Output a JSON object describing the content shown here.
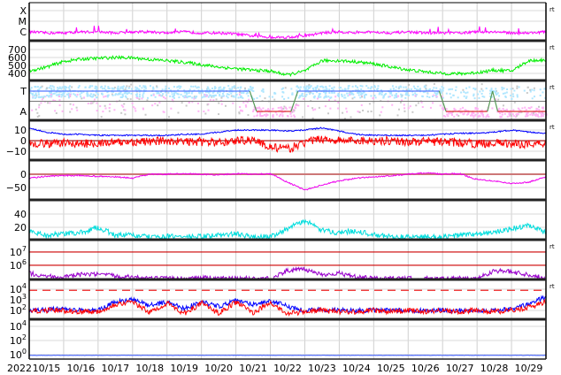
{
  "chart_data": {
    "type": "line",
    "title": "",
    "x_axis": {
      "year_label": "2022",
      "start": "10/15 00:00",
      "days": 15,
      "tick_labels": [
        "10/15",
        "10/16",
        "10/17",
        "10/18",
        "10/19",
        "10/20",
        "10/21",
        "10/22",
        "10/23",
        "10/24",
        "10/25",
        "10/26",
        "10/27",
        "10/28",
        "10/29"
      ]
    },
    "sample_step_days": 0.5,
    "panels": [
      {
        "name": "xray-flux",
        "scale": "log",
        "ylim": [
          -6.83,
          -3.25
        ],
        "rt": "rt",
        "ticks": [
          {
            "v": -4,
            "label": "X"
          },
          {
            "v": -5,
            "label": "M"
          },
          {
            "v": -6,
            "label": "C"
          }
        ],
        "series": [
          {
            "name": "xray",
            "color": "#ff00ff",
            "noise": 0.25,
            "spikes": 0.6,
            "values": [
              -6.0,
              -6.1,
              -6.1,
              -6.0,
              -6.0,
              -6.1,
              -6.0,
              -6.0,
              -6.1,
              -6.0,
              -6.1,
              -6.1,
              -6.2,
              -6.4,
              -6.5,
              -6.5,
              -6.4,
              -6.1,
              -6.0,
              -6.1,
              -6.0,
              -6.1,
              -6.0,
              -6.1,
              -6.1,
              -6.1,
              -6.0,
              -6.0,
              -6.1,
              -6.1,
              -6.0
            ]
          }
        ]
      },
      {
        "name": "solar-wind-speed",
        "scale": "linear",
        "ylim": [
          311,
          811
        ],
        "rt": "rt",
        "ticks": [
          {
            "v": 700,
            "label": "700"
          },
          {
            "v": 600,
            "label": "600"
          },
          {
            "v": 500,
            "label": "500"
          },
          {
            "v": 400,
            "label": "400"
          }
        ],
        "series": [
          {
            "name": "speed",
            "color": "#00ee00",
            "noise": 40,
            "values": [
              430,
              480,
              550,
              580,
              590,
              600,
              595,
              575,
              560,
              540,
              510,
              480,
              460,
              440,
              430,
              380,
              430,
              560,
              560,
              545,
              520,
              480,
              445,
              420,
              400,
              395,
              410,
              440,
              430,
              560,
              570
            ]
          }
        ]
      },
      {
        "name": "imf-sector",
        "scale": "category",
        "ylim": [
          -1.87,
          2.04
        ],
        "rt": "rt",
        "ticks": [
          {
            "v": 1,
            "label": "T"
          },
          {
            "v": -1,
            "label": "A"
          }
        ],
        "sectors": [
          {
            "from": 0,
            "to": 6.4,
            "value": "T"
          },
          {
            "from": 6.6,
            "to": 7.6,
            "value": "A"
          },
          {
            "from": 7.8,
            "to": 11.9,
            "value": "T"
          },
          {
            "from": 12.1,
            "to": 13.3,
            "value": "A"
          },
          {
            "from": 13.45,
            "to": 13.45,
            "value": "T"
          },
          {
            "from": 13.6,
            "to": 15,
            "value": "A"
          }
        ],
        "colors": {
          "toward": "#88ccff",
          "away": "#ff88ff",
          "toward_dots": "#aee6ff",
          "away_dots": "#ffb3f5",
          "mixed_dots": "#c8c8c8",
          "toward_line": "#5577ff",
          "away_line": "#dd3333",
          "transition": "#559955"
        }
      },
      {
        "name": "imf-bt-bz",
        "scale": "linear",
        "ylim": [
          -18.3,
          19.2
        ],
        "rt": "rt",
        "ticks": [
          {
            "v": 10,
            "label": "10"
          },
          {
            "v": 0,
            "label": "0"
          },
          {
            "v": -10,
            "label": "−10"
          }
        ],
        "refs": [
          {
            "v": 0,
            "color": "#990000"
          }
        ],
        "series": [
          {
            "name": "bz",
            "color": "#ff0000",
            "noise": 8,
            "values": [
              -2,
              -3,
              -2,
              -3,
              -2,
              -2,
              -1,
              -1,
              0,
              -1,
              -1,
              -2,
              0,
              1,
              -6,
              -8,
              -2,
              2,
              0,
              0,
              0,
              0,
              -1,
              -1,
              -1,
              -2,
              -3,
              -2,
              -3,
              -3,
              -2
            ]
          },
          {
            "name": "bt",
            "color": "#0000ff",
            "noise": 1.2,
            "values": [
              12,
              8,
              6,
              6,
              5,
              5,
              5,
              5,
              5,
              6,
              6,
              8,
              10,
              10,
              10,
              9,
              10,
              12,
              9,
              6,
              5,
              5,
              5,
              5,
              6,
              7,
              7,
              8,
              10,
              8,
              7
            ]
          }
        ]
      },
      {
        "name": "dst-index",
        "scale": "linear",
        "ylim": [
          -96.7,
          53.3
        ],
        "rt": "",
        "ticks": [
          {
            "v": 0,
            "label": "0"
          },
          {
            "v": -50,
            "label": "−50"
          }
        ],
        "refs": [
          {
            "v": 0,
            "color": "#cc7777",
            "width": 2
          }
        ],
        "series": [
          {
            "name": "dst",
            "color": "#ee00ee",
            "noise": 5,
            "values": [
              -15,
              -8,
              -5,
              -5,
              -8,
              -10,
              -15,
              0,
              0,
              2,
              0,
              -2,
              2,
              0,
              2,
              -30,
              -60,
              -40,
              -25,
              -15,
              -10,
              -5,
              0,
              5,
              0,
              2,
              -20,
              -25,
              -35,
              -30,
              -10
            ]
          }
        ]
      },
      {
        "name": "cyan-index",
        "scale": "linear",
        "ylim": [
          1.3,
          61.3
        ],
        "rt": "",
        "ticks": [
          {
            "v": 40,
            "label": "40"
          },
          {
            "v": 20,
            "label": "20"
          }
        ],
        "series": [
          {
            "name": "index",
            "color": "#00dddd",
            "noise": 8,
            "values": [
              15,
              8,
              10,
              12,
              20,
              8,
              8,
              5,
              6,
              6,
              6,
              8,
              10,
              5,
              6,
              18,
              30,
              15,
              12,
              15,
              8,
              6,
              5,
              6,
              5,
              8,
              10,
              12,
              18,
              22,
              12
            ]
          }
        ]
      },
      {
        "name": "electron-flux",
        "scale": "log",
        "ylim": [
          4.93,
          7.93
        ],
        "rt": "rt",
        "ticks": [
          {
            "v": 7,
            "label": "10",
            "exp": "7"
          },
          {
            "v": 6,
            "label": "10",
            "exp": "6"
          }
        ],
        "refs": [
          {
            "v": 7,
            "color": "#cc0000"
          },
          {
            "v": 6,
            "color": "#cc0000"
          }
        ],
        "series": [
          {
            "name": "electrons",
            "color": "#9900cc",
            "noise": 0.35,
            "values": [
              5.4,
              5.2,
              5.1,
              5.3,
              5.3,
              5.2,
              5.1,
              5.0,
              5.0,
              5.0,
              5.1,
              5.0,
              5.0,
              5.0,
              5.0,
              5.6,
              5.7,
              5.3,
              5.4,
              5.1,
              5.0,
              5.0,
              5.0,
              5.0,
              5.0,
              5.0,
              5.0,
              5.6,
              5.5,
              5.3,
              5.0
            ]
          }
        ]
      },
      {
        "name": "proton-flux",
        "scale": "log",
        "ylim": [
          1.17,
          4.92
        ],
        "rt": "rt",
        "ticks": [
          {
            "v": 4,
            "label": "10",
            "exp": "4"
          },
          {
            "v": 3,
            "label": "10",
            "exp": "3"
          },
          {
            "v": 2,
            "label": "10",
            "exp": "2"
          }
        ],
        "refs": [
          {
            "v": 3.9,
            "color": "#ee2222",
            "dash": true
          }
        ],
        "series": [
          {
            "name": "protons-blue",
            "color": "#0000ff",
            "noise": 0.45,
            "values": [
              2.0,
              2.1,
              2.1,
              2.0,
              2.0,
              2.8,
              3.0,
              2.5,
              2.8,
              2.2,
              2.8,
              2.4,
              2.9,
              2.6,
              2.9,
              2.4,
              2.0,
              2.1,
              2.0,
              2.0,
              2.0,
              2.0,
              2.0,
              2.0,
              2.0,
              2.0,
              2.0,
              2.0,
              2.1,
              2.6,
              3.3
            ]
          },
          {
            "name": "protons-red",
            "color": "#ff0000",
            "noise": 0.5,
            "values": [
              1.9,
              2.0,
              2.0,
              1.9,
              1.9,
              2.6,
              2.8,
              1.8,
              2.7,
              1.7,
              2.7,
              1.7,
              2.8,
              1.8,
              2.7,
              1.7,
              1.9,
              2.0,
              1.9,
              1.9,
              2.0,
              1.9,
              2.0,
              1.9,
              2.0,
              1.9,
              2.0,
              1.9,
              2.0,
              2.3,
              2.8
            ]
          }
        ]
      },
      {
        "name": "bottom-flux",
        "scale": "log",
        "ylim": [
          -0.63,
          5.0
        ],
        "rt": "",
        "ticks": [
          {
            "v": 4,
            "label": "10",
            "exp": "4"
          },
          {
            "v": 2,
            "label": "10",
            "exp": "2"
          },
          {
            "v": 0,
            "label": "10",
            "exp": "0"
          }
        ],
        "series": [
          {
            "name": "flux",
            "color": "#3355ff",
            "noise": 0.05,
            "values": [
              -0.1,
              -0.1,
              -0.1,
              -0.1,
              -0.1,
              -0.1,
              -0.1,
              -0.1,
              -0.1,
              -0.1,
              -0.1,
              -0.1,
              -0.1,
              -0.1,
              -0.1,
              -0.1,
              -0.1,
              -0.1,
              -0.1,
              -0.1,
              -0.1,
              -0.1,
              -0.1,
              -0.1,
              -0.1,
              -0.1,
              -0.1,
              -0.1,
              -0.1,
              -0.1,
              -0.1
            ]
          }
        ]
      }
    ]
  }
}
